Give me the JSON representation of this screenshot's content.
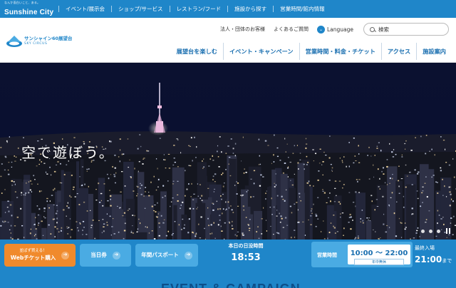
{
  "brand": {
    "tagline": "なんか面白いこと、ある。",
    "name": "Sunshine City"
  },
  "topnav": [
    "イベント/展示会",
    "ショップ/サービス",
    "レストラン/フード",
    "施設から探す",
    "営業時間/館内情報"
  ],
  "logo": {
    "title": "サンシャイン60展望台",
    "subtitle": "SKY CIRCUS"
  },
  "utility": {
    "corporate": "法人・団体のお客様",
    "faq": "よくあるご質問",
    "language": "Language"
  },
  "search": {
    "placeholder": "検索"
  },
  "mainnav": [
    "展望台を楽しむ",
    "イベント・キャンペーン",
    "営業時間・料金・チケット",
    "アクセス",
    "施設案内"
  ],
  "hero": {
    "headline": "空で遊ぼう。"
  },
  "tickets": {
    "web_sub": "並ばず買える！",
    "web_label": "Webチケット購入",
    "sameday": "当日券",
    "annual": "年間パスポート"
  },
  "sunset": {
    "label": "本日の日没時間",
    "time": "18:53"
  },
  "hours": {
    "label": "営業時間",
    "time": "10:00 〜 22:00",
    "closed": "年中無休"
  },
  "last_entry": {
    "label": "最終入場",
    "time": "21:00",
    "suffix": "まで"
  },
  "section": {
    "heading": "EVENT & CAMPAIGN"
  },
  "colors": {
    "primary": "#1f86c9",
    "accent": "#f08a2c",
    "light": "#4aabe3"
  }
}
